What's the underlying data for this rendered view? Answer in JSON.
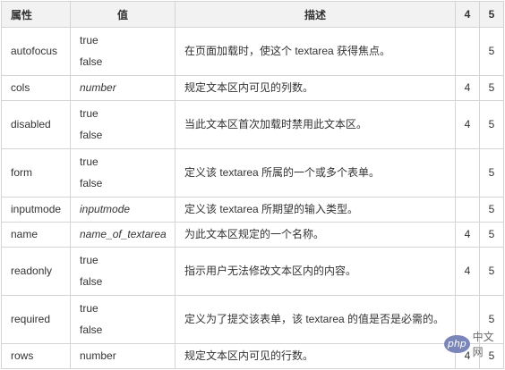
{
  "headers": [
    "属性",
    "值",
    "描述",
    "4",
    "5"
  ],
  "rows": [
    {
      "attr": "autofocus",
      "values": [
        "true",
        "false"
      ],
      "italic": false,
      "desc": "在页面加载时，使这个 textarea 获得焦点。",
      "c4": "",
      "c5": "5"
    },
    {
      "attr": "cols",
      "values": [
        "number"
      ],
      "italic": true,
      "desc": "规定文本区内可见的列数。",
      "c4": "4",
      "c5": "5"
    },
    {
      "attr": "disabled",
      "values": [
        "true",
        "false"
      ],
      "italic": false,
      "desc": "当此文本区首次加载时禁用此文本区。",
      "c4": "4",
      "c5": "5"
    },
    {
      "attr": "form",
      "values": [
        "true",
        "false"
      ],
      "italic": false,
      "desc": "定义该 textarea 所属的一个或多个表单。",
      "c4": "",
      "c5": "5"
    },
    {
      "attr": "inputmode",
      "values": [
        "inputmode"
      ],
      "italic": true,
      "desc": "定义该 textarea 所期望的输入类型。",
      "c4": "",
      "c5": "5"
    },
    {
      "attr": "name",
      "values": [
        "name_of_textarea"
      ],
      "italic": true,
      "desc": "为此文本区规定的一个名称。",
      "c4": "4",
      "c5": "5"
    },
    {
      "attr": "readonly",
      "values": [
        "true",
        "false"
      ],
      "italic": false,
      "desc": "指示用户无法修改文本区内的内容。",
      "c4": "4",
      "c5": "5"
    },
    {
      "attr": "required",
      "values": [
        "true",
        "false"
      ],
      "italic": false,
      "desc": "定义为了提交该表单，该 textarea 的值是否是必需的。",
      "c4": "",
      "c5": "5"
    },
    {
      "attr": "rows",
      "values": [
        "number"
      ],
      "italic": false,
      "desc": "规定文本区内可见的行数。",
      "c4": "4",
      "c5": "5"
    }
  ],
  "watermark": {
    "logo": "php",
    "text": "中文网"
  }
}
